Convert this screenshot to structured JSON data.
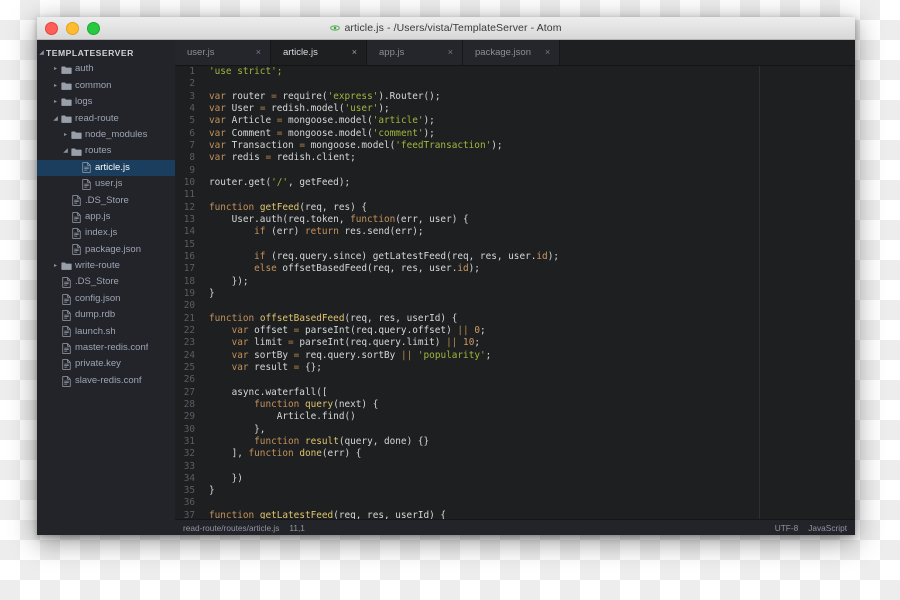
{
  "window": {
    "title": "article.js - /Users/vista/TemplateServer - Atom",
    "app_icon": "atom-icon",
    "controls": {
      "close_label": "close-window",
      "minimize_label": "minimize-window",
      "zoom_label": "zoom-window"
    },
    "colors": {
      "close": "#ff5f57",
      "minimize": "#ffbd2e",
      "zoom": "#28c940",
      "editor_bg": "#1d1f21",
      "sidebar_bg": "#22242a",
      "selection": "#1c3e5e",
      "keyword": "#c5915a",
      "string": "#a0b63c",
      "function_name": "#e0c46c",
      "text": "#d5d8d6",
      "line_number": "#5a5d63"
    }
  },
  "sidebar": {
    "root_label": "TEMPLATESERVER",
    "items": [
      {
        "label": "auth",
        "type": "folder",
        "depth": 1,
        "state": "collapsed",
        "selected": false
      },
      {
        "label": "common",
        "type": "folder",
        "depth": 1,
        "state": "collapsed",
        "selected": false
      },
      {
        "label": "logs",
        "type": "folder",
        "depth": 1,
        "state": "collapsed",
        "selected": false
      },
      {
        "label": "read-route",
        "type": "folder",
        "depth": 1,
        "state": "expanded",
        "selected": false
      },
      {
        "label": "node_modules",
        "type": "folder",
        "depth": 2,
        "state": "collapsed",
        "selected": false
      },
      {
        "label": "routes",
        "type": "folder",
        "depth": 2,
        "state": "expanded",
        "selected": false
      },
      {
        "label": "article.js",
        "type": "file",
        "depth": 3,
        "state": "none",
        "selected": true
      },
      {
        "label": "user.js",
        "type": "file",
        "depth": 3,
        "state": "none",
        "selected": false
      },
      {
        "label": ".DS_Store",
        "type": "file",
        "depth": 2,
        "state": "none",
        "selected": false
      },
      {
        "label": "app.js",
        "type": "file",
        "depth": 2,
        "state": "none",
        "selected": false
      },
      {
        "label": "index.js",
        "type": "file",
        "depth": 2,
        "state": "none",
        "selected": false
      },
      {
        "label": "package.json",
        "type": "file",
        "depth": 2,
        "state": "none",
        "selected": false
      },
      {
        "label": "write-route",
        "type": "folder",
        "depth": 1,
        "state": "collapsed",
        "selected": false
      },
      {
        "label": ".DS_Store",
        "type": "file",
        "depth": 1,
        "state": "none",
        "selected": false
      },
      {
        "label": "config.json",
        "type": "file",
        "depth": 1,
        "state": "none",
        "selected": false
      },
      {
        "label": "dump.rdb",
        "type": "file",
        "depth": 1,
        "state": "none",
        "selected": false
      },
      {
        "label": "launch.sh",
        "type": "file",
        "depth": 1,
        "state": "none",
        "selected": false
      },
      {
        "label": "master-redis.conf",
        "type": "file",
        "depth": 1,
        "state": "none",
        "selected": false
      },
      {
        "label": "private.key",
        "type": "file",
        "depth": 1,
        "state": "none",
        "selected": false
      },
      {
        "label": "slave-redis.conf",
        "type": "file",
        "depth": 1,
        "state": "none",
        "selected": false
      }
    ]
  },
  "tabs": {
    "close_glyph": "×",
    "items": [
      {
        "label": "user.js",
        "active": false
      },
      {
        "label": "article.js",
        "active": true
      },
      {
        "label": "app.js",
        "active": false
      },
      {
        "label": "package.json",
        "active": false
      }
    ]
  },
  "editor": {
    "lines": [
      {
        "n": 1,
        "tokens": [
          {
            "t": "'use strict';",
            "c": "str"
          }
        ]
      },
      {
        "n": 2,
        "tokens": []
      },
      {
        "n": 3,
        "tokens": [
          {
            "t": "var",
            "c": "k"
          },
          {
            "t": " router ",
            "c": "pl"
          },
          {
            "t": "=",
            "c": "op"
          },
          {
            "t": " require(",
            "c": "pl"
          },
          {
            "t": "'express'",
            "c": "str"
          },
          {
            "t": ").Router();",
            "c": "pl"
          }
        ]
      },
      {
        "n": 4,
        "tokens": [
          {
            "t": "var",
            "c": "k"
          },
          {
            "t": " User ",
            "c": "pl"
          },
          {
            "t": "=",
            "c": "op"
          },
          {
            "t": " redish.model(",
            "c": "pl"
          },
          {
            "t": "'user'",
            "c": "str"
          },
          {
            "t": ");",
            "c": "pl"
          }
        ]
      },
      {
        "n": 5,
        "tokens": [
          {
            "t": "var",
            "c": "k"
          },
          {
            "t": " Article ",
            "c": "pl"
          },
          {
            "t": "=",
            "c": "op"
          },
          {
            "t": " mongoose.model(",
            "c": "pl"
          },
          {
            "t": "'article'",
            "c": "str"
          },
          {
            "t": ");",
            "c": "pl"
          }
        ]
      },
      {
        "n": 6,
        "tokens": [
          {
            "t": "var",
            "c": "k"
          },
          {
            "t": " Comment ",
            "c": "pl"
          },
          {
            "t": "=",
            "c": "op"
          },
          {
            "t": " mongoose.model(",
            "c": "pl"
          },
          {
            "t": "'comment'",
            "c": "str"
          },
          {
            "t": ");",
            "c": "pl"
          }
        ]
      },
      {
        "n": 7,
        "tokens": [
          {
            "t": "var",
            "c": "k"
          },
          {
            "t": " Transaction ",
            "c": "pl"
          },
          {
            "t": "=",
            "c": "op"
          },
          {
            "t": " mongoose.model(",
            "c": "pl"
          },
          {
            "t": "'feedTransaction'",
            "c": "str"
          },
          {
            "t": ");",
            "c": "pl"
          }
        ]
      },
      {
        "n": 8,
        "tokens": [
          {
            "t": "var",
            "c": "k"
          },
          {
            "t": " redis ",
            "c": "pl"
          },
          {
            "t": "=",
            "c": "op"
          },
          {
            "t": " redish.client;",
            "c": "pl"
          }
        ]
      },
      {
        "n": 9,
        "tokens": []
      },
      {
        "n": 10,
        "tokens": [
          {
            "t": "router.get(",
            "c": "pl"
          },
          {
            "t": "'/'",
            "c": "str"
          },
          {
            "t": ", getFeed);",
            "c": "pl"
          }
        ]
      },
      {
        "n": 11,
        "tokens": []
      },
      {
        "n": 12,
        "tokens": [
          {
            "t": "function",
            "c": "k"
          },
          {
            "t": " ",
            "c": "pl"
          },
          {
            "t": "getFeed",
            "c": "fn"
          },
          {
            "t": "(req, res) {",
            "c": "pl"
          }
        ]
      },
      {
        "n": 13,
        "tokens": [
          {
            "t": "    User.auth(req.token, ",
            "c": "pl"
          },
          {
            "t": "function",
            "c": "k"
          },
          {
            "t": "(err, user) {",
            "c": "pl"
          }
        ]
      },
      {
        "n": 14,
        "tokens": [
          {
            "t": "        ",
            "c": "pl"
          },
          {
            "t": "if",
            "c": "k"
          },
          {
            "t": " (err) ",
            "c": "pl"
          },
          {
            "t": "return",
            "c": "k"
          },
          {
            "t": " res.send(err);",
            "c": "pl"
          }
        ]
      },
      {
        "n": 15,
        "tokens": []
      },
      {
        "n": 16,
        "tokens": [
          {
            "t": "        ",
            "c": "pl"
          },
          {
            "t": "if",
            "c": "k"
          },
          {
            "t": " (req.query.since) getLatestFeed(req, res, user.",
            "c": "pl"
          },
          {
            "t": "id",
            "c": "prop"
          },
          {
            "t": ");",
            "c": "pl"
          }
        ]
      },
      {
        "n": 17,
        "tokens": [
          {
            "t": "        ",
            "c": "pl"
          },
          {
            "t": "else",
            "c": "k"
          },
          {
            "t": " offsetBasedFeed(req, res, user.",
            "c": "pl"
          },
          {
            "t": "id",
            "c": "prop"
          },
          {
            "t": ");",
            "c": "pl"
          }
        ]
      },
      {
        "n": 18,
        "tokens": [
          {
            "t": "    });",
            "c": "pl"
          }
        ]
      },
      {
        "n": 19,
        "tokens": [
          {
            "t": "}",
            "c": "pl"
          }
        ]
      },
      {
        "n": 20,
        "tokens": []
      },
      {
        "n": 21,
        "tokens": [
          {
            "t": "function",
            "c": "k"
          },
          {
            "t": " ",
            "c": "pl"
          },
          {
            "t": "offsetBasedFeed",
            "c": "fn"
          },
          {
            "t": "(req, res, userId) {",
            "c": "pl"
          }
        ]
      },
      {
        "n": 22,
        "tokens": [
          {
            "t": "    ",
            "c": "pl"
          },
          {
            "t": "var",
            "c": "k"
          },
          {
            "t": " offset ",
            "c": "pl"
          },
          {
            "t": "=",
            "c": "op"
          },
          {
            "t": " parseInt(req.query.offset) ",
            "c": "pl"
          },
          {
            "t": "||",
            "c": "op"
          },
          {
            "t": " ",
            "c": "pl"
          },
          {
            "t": "0",
            "c": "num"
          },
          {
            "t": ";",
            "c": "pl"
          }
        ]
      },
      {
        "n": 23,
        "tokens": [
          {
            "t": "    ",
            "c": "pl"
          },
          {
            "t": "var",
            "c": "k"
          },
          {
            "t": " limit ",
            "c": "pl"
          },
          {
            "t": "=",
            "c": "op"
          },
          {
            "t": " parseInt(req.query.limit) ",
            "c": "pl"
          },
          {
            "t": "||",
            "c": "op"
          },
          {
            "t": " ",
            "c": "pl"
          },
          {
            "t": "10",
            "c": "num"
          },
          {
            "t": ";",
            "c": "pl"
          }
        ]
      },
      {
        "n": 24,
        "tokens": [
          {
            "t": "    ",
            "c": "pl"
          },
          {
            "t": "var",
            "c": "k"
          },
          {
            "t": " sortBy ",
            "c": "pl"
          },
          {
            "t": "=",
            "c": "op"
          },
          {
            "t": " req.query.sortBy ",
            "c": "pl"
          },
          {
            "t": "||",
            "c": "op"
          },
          {
            "t": " ",
            "c": "pl"
          },
          {
            "t": "'popularity'",
            "c": "str"
          },
          {
            "t": ";",
            "c": "pl"
          }
        ]
      },
      {
        "n": 25,
        "tokens": [
          {
            "t": "    ",
            "c": "pl"
          },
          {
            "t": "var",
            "c": "k"
          },
          {
            "t": " result ",
            "c": "pl"
          },
          {
            "t": "=",
            "c": "op"
          },
          {
            "t": " {};",
            "c": "pl"
          }
        ]
      },
      {
        "n": 26,
        "tokens": []
      },
      {
        "n": 27,
        "tokens": [
          {
            "t": "    async.waterfall([",
            "c": "pl"
          }
        ]
      },
      {
        "n": 28,
        "tokens": [
          {
            "t": "        ",
            "c": "pl"
          },
          {
            "t": "function",
            "c": "k"
          },
          {
            "t": " ",
            "c": "pl"
          },
          {
            "t": "query",
            "c": "fn"
          },
          {
            "t": "(next) {",
            "c": "pl"
          }
        ]
      },
      {
        "n": 29,
        "tokens": [
          {
            "t": "            Article.find()",
            "c": "pl"
          }
        ]
      },
      {
        "n": 30,
        "tokens": [
          {
            "t": "        },",
            "c": "pl"
          }
        ]
      },
      {
        "n": 31,
        "tokens": [
          {
            "t": "        ",
            "c": "pl"
          },
          {
            "t": "function",
            "c": "k"
          },
          {
            "t": " ",
            "c": "pl"
          },
          {
            "t": "result",
            "c": "fn"
          },
          {
            "t": "(query, done) {}",
            "c": "pl"
          }
        ]
      },
      {
        "n": 32,
        "tokens": [
          {
            "t": "    ], ",
            "c": "pl"
          },
          {
            "t": "function",
            "c": "k"
          },
          {
            "t": " ",
            "c": "pl"
          },
          {
            "t": "done",
            "c": "fn"
          },
          {
            "t": "(err) {",
            "c": "pl"
          }
        ]
      },
      {
        "n": 33,
        "tokens": []
      },
      {
        "n": 34,
        "tokens": [
          {
            "t": "    })",
            "c": "pl"
          }
        ]
      },
      {
        "n": 35,
        "tokens": [
          {
            "t": "}",
            "c": "pl"
          }
        ]
      },
      {
        "n": 36,
        "tokens": []
      },
      {
        "n": 37,
        "tokens": [
          {
            "t": "function",
            "c": "k"
          },
          {
            "t": " ",
            "c": "pl"
          },
          {
            "t": "getLatestFeed",
            "c": "fn"
          },
          {
            "t": "(req, res, userId) {",
            "c": "pl"
          }
        ]
      }
    ]
  },
  "status_bar": {
    "file_path": "read-route/routes/article.js",
    "cursor_position": "11,1",
    "encoding": "UTF-8",
    "grammar": "JavaScript"
  }
}
